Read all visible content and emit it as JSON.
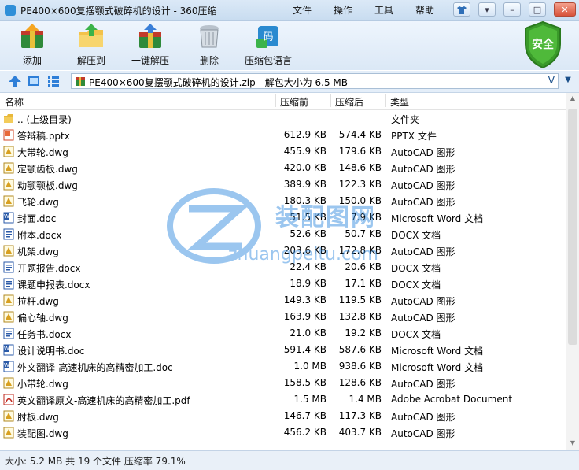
{
  "window": {
    "title": "PE400×600复摆颚式破碎机的设计 - 360压缩",
    "menu": [
      "文件",
      "操作",
      "工具",
      "帮助"
    ],
    "controls": [
      "shirt-icon",
      "menu-icon",
      "minimize-icon",
      "maximize-icon",
      "close-icon"
    ]
  },
  "toolbar": {
    "buttons": [
      {
        "label": "添加",
        "icon": "add-archive-icon"
      },
      {
        "label": "解压到",
        "icon": "extract-folder-icon"
      },
      {
        "label": "一键解压",
        "icon": "one-click-extract-icon"
      },
      {
        "label": "删除",
        "icon": "trash-icon"
      },
      {
        "label": "压缩包语言",
        "icon": "archive-language-icon"
      }
    ],
    "security_badge": "安全"
  },
  "address": {
    "path": "PE400×600复摆颚式破碎机的设计.zip - 解包大小为 6.5 MB",
    "dropdown_glyph": "V"
  },
  "columns": {
    "name": "名称",
    "compressed": "压缩前",
    "original": "压缩后",
    "type": "类型"
  },
  "files": [
    {
      "name": ".. (上级目录)",
      "compressed": "",
      "original": "",
      "type": "文件夹",
      "kind": "folder"
    },
    {
      "name": "答辩稿.pptx",
      "compressed": "612.9 KB",
      "original": "574.4 KB",
      "type": "PPTX 文件",
      "kind": "pptx"
    },
    {
      "name": "大带轮.dwg",
      "compressed": "455.9 KB",
      "original": "179.6 KB",
      "type": "AutoCAD 图形",
      "kind": "dwg"
    },
    {
      "name": "定颚齿板.dwg",
      "compressed": "420.0 KB",
      "original": "148.6 KB",
      "type": "AutoCAD 图形",
      "kind": "dwg"
    },
    {
      "name": "动颚颚板.dwg",
      "compressed": "389.9 KB",
      "original": "122.3 KB",
      "type": "AutoCAD 图形",
      "kind": "dwg"
    },
    {
      "name": "飞轮.dwg",
      "compressed": "180.3 KB",
      "original": "150.0 KB",
      "type": "AutoCAD 图形",
      "kind": "dwg"
    },
    {
      "name": "封面.doc",
      "compressed": "51.5 KB",
      "original": "7.9 KB",
      "type": "Microsoft Word 文档",
      "kind": "doc"
    },
    {
      "name": "附本.docx",
      "compressed": "52.6 KB",
      "original": "50.7 KB",
      "type": "DOCX 文档",
      "kind": "docx"
    },
    {
      "name": "机架.dwg",
      "compressed": "203.6 KB",
      "original": "172.8 KB",
      "type": "AutoCAD 图形",
      "kind": "dwg"
    },
    {
      "name": "开题报告.docx",
      "compressed": "22.4 KB",
      "original": "20.6 KB",
      "type": "DOCX 文档",
      "kind": "docx"
    },
    {
      "name": "课题申报表.docx",
      "compressed": "18.9 KB",
      "original": "17.1 KB",
      "type": "DOCX 文档",
      "kind": "docx"
    },
    {
      "name": "拉杆.dwg",
      "compressed": "149.3 KB",
      "original": "119.5 KB",
      "type": "AutoCAD 图形",
      "kind": "dwg"
    },
    {
      "name": "偏心轴.dwg",
      "compressed": "163.9 KB",
      "original": "132.8 KB",
      "type": "AutoCAD 图形",
      "kind": "dwg"
    },
    {
      "name": "任务书.docx",
      "compressed": "21.0 KB",
      "original": "19.2 KB",
      "type": "DOCX 文档",
      "kind": "docx"
    },
    {
      "name": "设计说明书.doc",
      "compressed": "591.4 KB",
      "original": "587.6 KB",
      "type": "Microsoft Word 文档",
      "kind": "doc"
    },
    {
      "name": "外文翻译-高速机床的高精密加工.doc",
      "compressed": "1.0 MB",
      "original": "938.6 KB",
      "type": "Microsoft Word 文档",
      "kind": "doc"
    },
    {
      "name": "小带轮.dwg",
      "compressed": "158.5 KB",
      "original": "128.6 KB",
      "type": "AutoCAD 图形",
      "kind": "dwg"
    },
    {
      "name": "英文翻译原文-高速机床的高精密加工.pdf",
      "compressed": "1.5 MB",
      "original": "1.4 MB",
      "type": "Adobe Acrobat Document",
      "kind": "pdf"
    },
    {
      "name": "肘板.dwg",
      "compressed": "146.7 KB",
      "original": "117.3 KB",
      "type": "AutoCAD 图形",
      "kind": "dwg"
    },
    {
      "name": "装配图.dwg",
      "compressed": "456.2 KB",
      "original": "403.7 KB",
      "type": "AutoCAD 图形",
      "kind": "dwg"
    }
  ],
  "watermark": {
    "cn": "装配图网",
    "url": "zhuangpeitu.com"
  },
  "status": {
    "text": "大小: 5.2 MB 共 19 个文件 压缩率 79.1%"
  },
  "colors": {
    "titlebar": "#c8dcf0",
    "toolbar": "#dbe8f6",
    "accent": "#2f8fd8",
    "shield_green": "#3a9a2a",
    "close_red": "#d8533a",
    "watermark": "#3a8fe0"
  }
}
